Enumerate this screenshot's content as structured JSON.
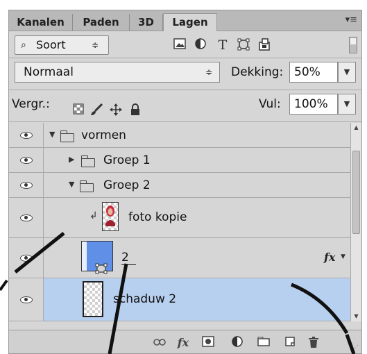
{
  "tabs": [
    {
      "label": "Kanalen",
      "active": false
    },
    {
      "label": "Paden",
      "active": false
    },
    {
      "label": "3D",
      "active": false
    },
    {
      "label": "Lagen",
      "active": true
    }
  ],
  "filter": {
    "kind_label": "Soort",
    "icons": [
      "image-filter-icon",
      "adjustment-filter-icon",
      "type-filter-icon",
      "shape-filter-icon",
      "smart-object-filter-icon"
    ]
  },
  "blend": {
    "mode": "Normaal",
    "opacity_label": "Dekking:",
    "opacity_value": "50%",
    "fill_label": "Vul:",
    "fill_value": "100%"
  },
  "lock": {
    "label": "Vergr.:",
    "icons": [
      "lock-transparent-icon",
      "lock-image-icon",
      "lock-position-icon",
      "lock-all-icon"
    ]
  },
  "layers": [
    {
      "name": "vormen",
      "type": "group",
      "expanded": true,
      "level": 0,
      "visible": true
    },
    {
      "name": "Groep 1",
      "type": "group",
      "expanded": false,
      "level": 1,
      "visible": true
    },
    {
      "name": "Groep 2",
      "type": "group",
      "expanded": true,
      "level": 1,
      "visible": true
    },
    {
      "name": "foto kopie",
      "type": "layer",
      "clipped": true,
      "level": 2,
      "visible": true
    },
    {
      "name": "2",
      "type": "shape",
      "has_fx": true,
      "level": 2,
      "visible": true
    },
    {
      "name": "schaduw 2",
      "type": "layer",
      "level": 2,
      "visible": true,
      "selected": true
    }
  ],
  "bottom_icons": [
    "link-layers-icon",
    "fx-icon",
    "add-mask-icon",
    "adjustment-layer-icon",
    "new-group-icon",
    "new-layer-icon",
    "delete-icon"
  ],
  "colors": {
    "selected_row": "#b8d0ef",
    "shape_thumb": "#5f8fe6"
  }
}
